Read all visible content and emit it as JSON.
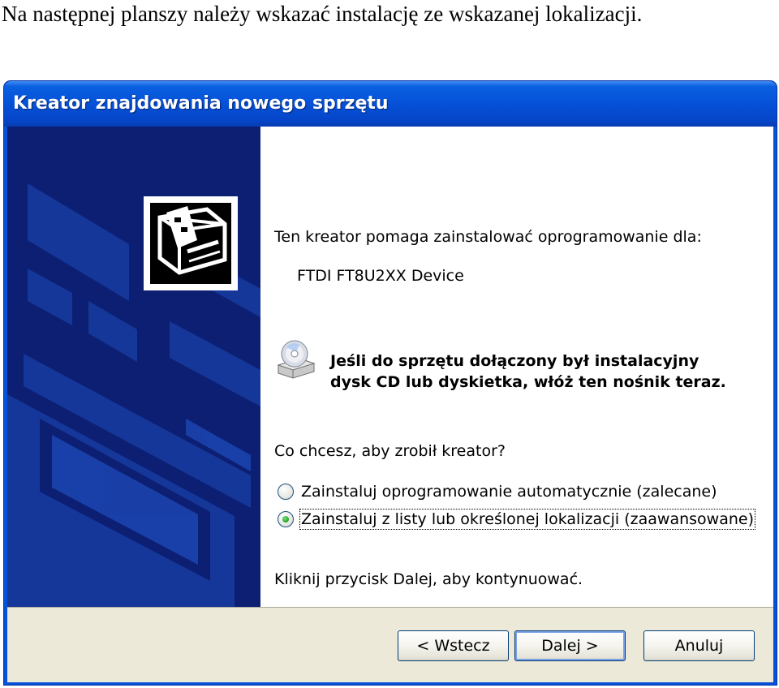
{
  "caption": "Na następnej planszy należy wskazać instalację ze wskazanej lokalizacji.",
  "window": {
    "title": "Kreator znajdowania nowego sprzętu"
  },
  "content": {
    "intro": "Ten kreator pomaga zainstalować oprogramowanie dla:",
    "device": "FTDI FT8U2XX Device",
    "notice_line1": "Jeśli do sprzętu dołączony był instalacyjny",
    "notice_line2": "dysk CD lub dyskietka, włóż ten nośnik teraz.",
    "question": "Co chcesz, aby zrobił kreator?",
    "options": [
      {
        "label": "Zainstaluj oprogramowanie automatycznie (zalecane)",
        "checked": false
      },
      {
        "label": "Zainstaluj z listy lub określonej lokalizacji (zaawansowane)",
        "checked": true
      }
    ],
    "hint": "Kliknij przycisk Dalej, aby kontynuować."
  },
  "buttons": {
    "back": "< Wstecz",
    "next": "Dalej >",
    "cancel": "Anuluj"
  },
  "icons": {
    "hardware": "hardware-wizard-icon",
    "cd": "cd-drive-icon"
  },
  "colors": {
    "title_bar": "#0551d8",
    "side_panel": "#0c1f73",
    "button_area": "#ece9d8"
  }
}
